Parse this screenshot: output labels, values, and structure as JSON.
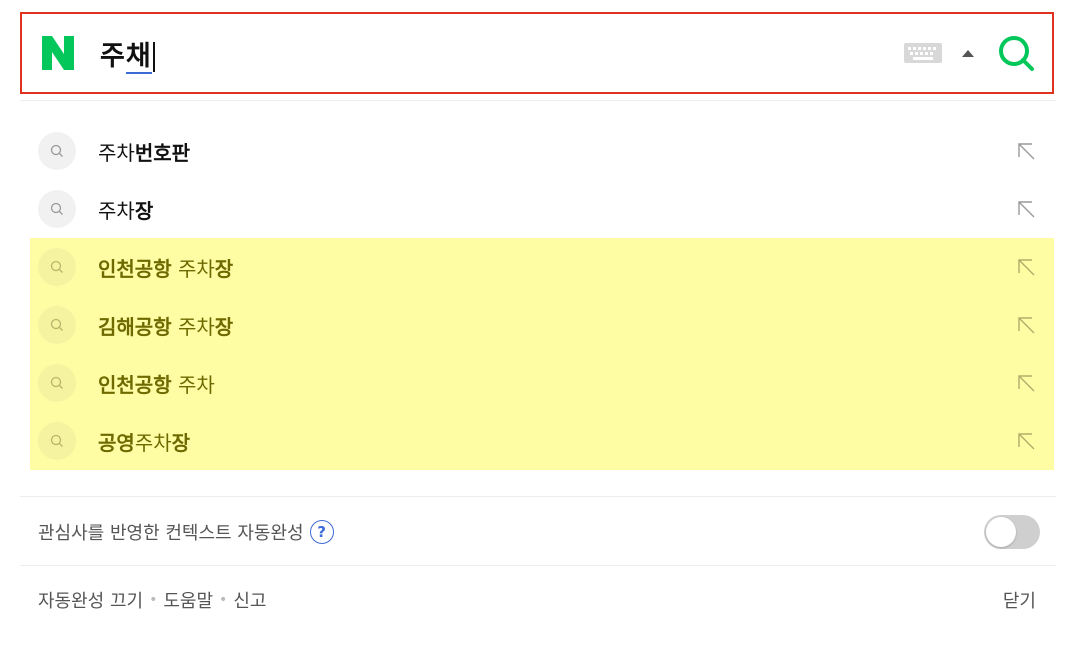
{
  "search": {
    "query_prefix": "주",
    "query_last": "채",
    "logo_letter": "N"
  },
  "suggestions": [
    {
      "base": "주차",
      "rest": "번호판",
      "highlight": false
    },
    {
      "base": "주차",
      "rest": "장",
      "highlight": false
    },
    {
      "bold_prefix": "인천공항",
      "base": " 주차",
      "rest": "장",
      "highlight": true
    },
    {
      "bold_prefix": "김해공항",
      "base": " 주차",
      "rest": "장",
      "highlight": true
    },
    {
      "bold_prefix": "인천공항",
      "base": " 주차",
      "rest": "",
      "highlight": true
    },
    {
      "bold_prefix": "공영",
      "base": "주차",
      "rest": "장",
      "highlight": true
    }
  ],
  "context": {
    "label": "관심사를 반영한 컨텍스트 자동완성",
    "help": "?",
    "toggle_on": false
  },
  "footer": {
    "autocomplete_off": "자동완성 끄기",
    "help": "도움말",
    "report": "신고",
    "close": "닫기"
  },
  "colors": {
    "border": "#e0331f",
    "brand_green": "#03c75a",
    "highlight_bg": "#fefda4",
    "link_blue": "#3d6bd6"
  }
}
